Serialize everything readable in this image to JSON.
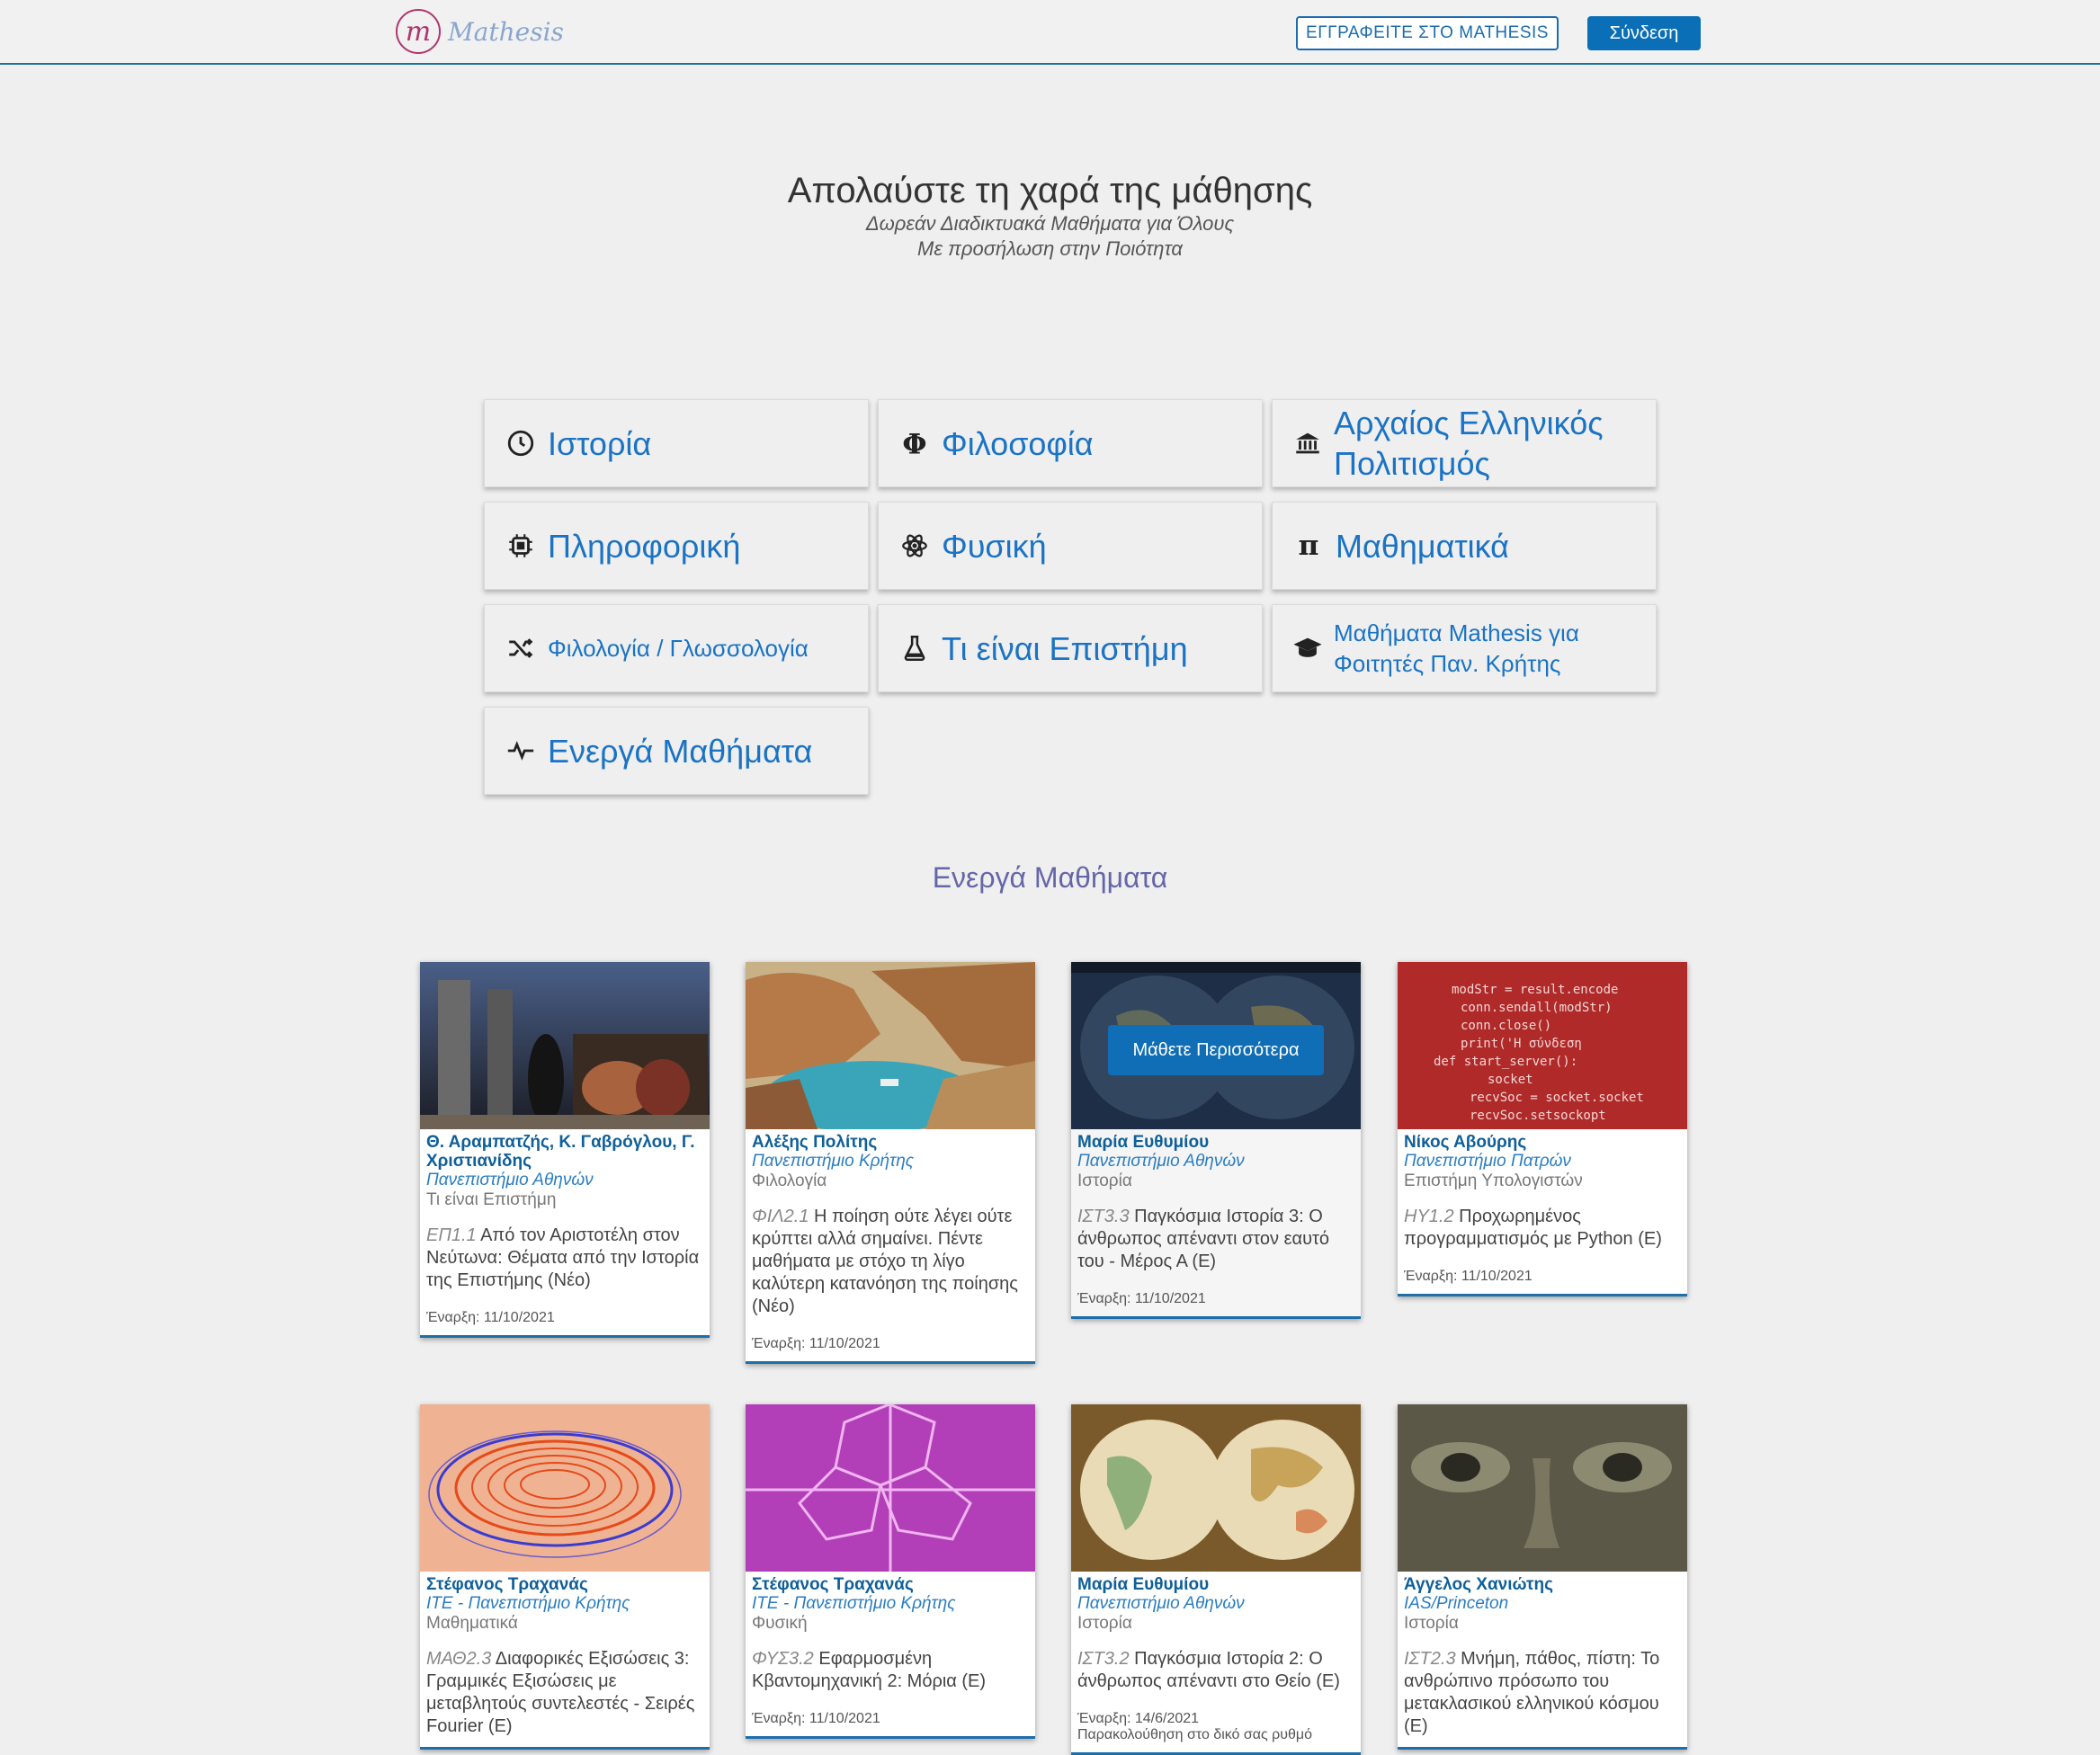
{
  "header": {
    "logo_text": "Mathesis",
    "register_label": "ΕΓΓΡΑΦΕΙΤΕ ΣΤΟ MATHESIS",
    "login_label": "Σύνδεση"
  },
  "hero": {
    "title": "Απολαύστε τη χαρά της μάθησης",
    "subtitle1": "Δωρεάν Διαδικτυακά Μαθήματα για Όλους",
    "subtitle2": "Με προσήλωση στην Ποιότητα"
  },
  "categories": [
    {
      "label": "Ιστορία",
      "icon": "history-clock-icon"
    },
    {
      "label": "Φιλοσοφία",
      "icon": "phi-icon"
    },
    {
      "label": "Αρχαίος Ελληνικός Πολιτισμός",
      "icon": "temple-icon"
    },
    {
      "label": "Πληροφορική",
      "icon": "chip-icon"
    },
    {
      "label": "Φυσική",
      "icon": "atom-icon"
    },
    {
      "label": "Μαθηματικά",
      "icon": "pi-icon"
    },
    {
      "label": "Φιλολογία / Γλωσσολογία",
      "icon": "shuffle-icon"
    },
    {
      "label": "Τι είναι Επιστήμη",
      "icon": "flask-icon"
    },
    {
      "label": "Μαθήματα Mathesis για Φοιτητές Παν. Κρήτης",
      "icon": "graduation-cap-icon"
    },
    {
      "label": "Ενεργά Μαθήματα",
      "icon": "pulse-icon"
    }
  ],
  "section_title": "Ενεργά Μαθήματα",
  "learn_more_label": "Μάθετε Περισσότερα",
  "courses": [
    {
      "author": "Θ. Αραμπατζής, Κ. Γαβρόγλου, Γ. Χριστιανίδης",
      "university": "Πανεπιστήμιο Αθηνών",
      "field": "Τι είναι Επιστήμη",
      "code": "ΕΠ1.1",
      "title": "Από τον Αριστοτέλη στον Νεύτωνα: Θέματα από την Ιστορία της Επιστήμης (Νέο)",
      "start": "Έναρξη: 11/10/2021",
      "extra": ""
    },
    {
      "author": "Αλέξης Πολίτης",
      "university": "Πανεπιστήμιο Κρήτης",
      "field": "Φιλολογία",
      "code": "ΦΙΛ2.1",
      "title": "Η ποίηση ούτε λέγει ούτε κρύπτει αλλά σημαίνει. Πέντε μαθήματα με στόχο τη λίγο καλύτερη κατανόηση της ποίησης (Νέο)",
      "start": "Έναρξη: 11/10/2021",
      "extra": ""
    },
    {
      "author": "Μαρία Ευθυμίου",
      "university": "Πανεπιστήμιο Αθηνών",
      "field": "Ιστορία",
      "code": "ΙΣΤ3.3",
      "title": "Παγκόσμια Ιστορία 3: Ο άνθρωπος απέναντι στον εαυτό του - Μέρος Α (Ε)",
      "start": "Έναρξη: 11/10/2021",
      "extra": ""
    },
    {
      "author": "Νίκος Αβούρης",
      "university": "Πανεπιστήμιο Πατρών",
      "field": "Επιστήμη Υπολογιστών",
      "code": "ΗΥ1.2",
      "title": "Προχωρημένος προγραμματισμός με Python (Ε)",
      "start": "Έναρξη: 11/10/2021",
      "extra": ""
    },
    {
      "author": "Στέφανος Τραχανάς",
      "university": "ΙΤΕ - Πανεπιστήμιο Κρήτης",
      "field": "Μαθηματικά",
      "code": "ΜΑΘ2.3",
      "title": "Διαφορικές Εξισώσεις 3: Γραμμικές Εξισώσεις με μεταβλητούς συντελεστές - Σειρές Fourier (Ε)",
      "start": "",
      "extra": ""
    },
    {
      "author": "Στέφανος Τραχανάς",
      "university": "ΙΤΕ - Πανεπιστήμιο Κρήτης",
      "field": "Φυσική",
      "code": "ΦΥΣ3.2",
      "title": "Εφαρμοσμένη Κβαντομηχανική 2: Μόρια (Ε)",
      "start": "Έναρξη: 11/10/2021",
      "extra": ""
    },
    {
      "author": "Μαρία Ευθυμίου",
      "university": "Πανεπιστήμιο Αθηνών",
      "field": "Ιστορία",
      "code": "ΙΣΤ3.2",
      "title": "Παγκόσμια Ιστορία 2: Ο άνθρωπος απέναντι στο Θείο (Ε)",
      "start": "Έναρξη: 14/6/2021",
      "extra": "Παρακολούθηση στο δικό σας ρυθμό"
    },
    {
      "author": "Άγγελος Χανιώτης",
      "university": "IAS/Princeton",
      "field": "Ιστορία",
      "code": "ΙΣΤ2.3",
      "title": "Μνήμη, πάθος, πίστη: Το ανθρώπινο πρόσωπο του μετακλασικού ελληνικού κόσμου (Ε)",
      "start": "",
      "extra": ""
    }
  ]
}
